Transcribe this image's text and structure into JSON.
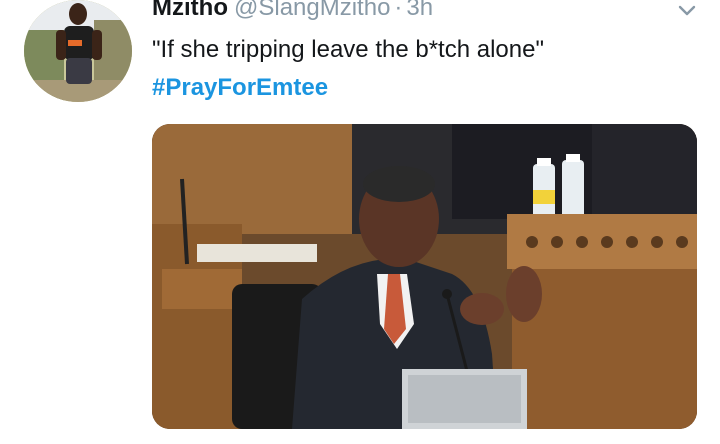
{
  "tweet": {
    "display_name": "Mzitho",
    "handle": "@SlangMzitho",
    "separator": "·",
    "time": "3h",
    "text": "\"If she tripping leave the b*tch alone\"",
    "hashtag": "#PrayForEmtee"
  },
  "colors": {
    "name": "#14171a",
    "secondary": "#8899a6",
    "link": "#1b95e0"
  },
  "icons": {
    "more": "chevron-down-icon"
  }
}
